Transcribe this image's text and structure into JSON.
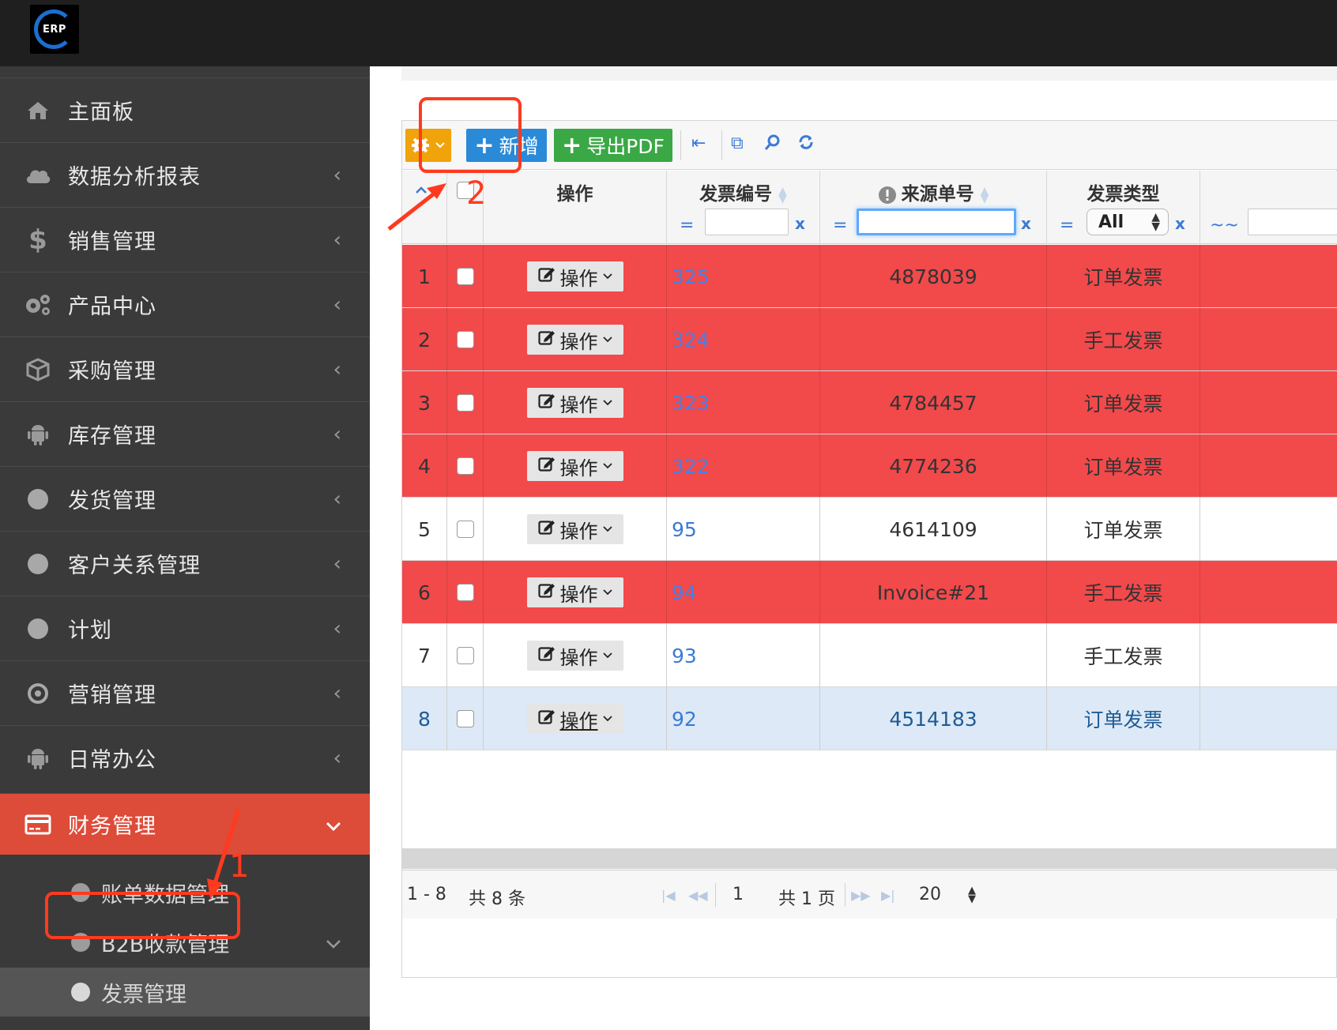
{
  "header": {
    "logo_text": "ERP"
  },
  "sidebar": {
    "items": [
      {
        "label": "主面板",
        "icon": "home-icon"
      },
      {
        "label": "数据分析报表",
        "icon": "cloud-icon"
      },
      {
        "label": "销售管理",
        "icon": "dollar-icon"
      },
      {
        "label": "产品中心",
        "icon": "gears-icon"
      },
      {
        "label": "采购管理",
        "icon": "cube-icon"
      },
      {
        "label": "库存管理",
        "icon": "android-icon"
      },
      {
        "label": "发货管理",
        "icon": "circle-icon"
      },
      {
        "label": "客户关系管理",
        "icon": "circle-icon"
      },
      {
        "label": "计划",
        "icon": "circle-icon"
      },
      {
        "label": "营销管理",
        "icon": "target-icon"
      },
      {
        "label": "日常办公",
        "icon": "android-icon"
      },
      {
        "label": "财务管理",
        "icon": "credit-card-icon"
      }
    ],
    "sub_items": [
      {
        "label": "账单数据管理"
      },
      {
        "label": "B2B收款管理"
      },
      {
        "label": "发票管理"
      }
    ],
    "chevron_left": "‹",
    "chevron_down": "⌄"
  },
  "toolbar": {
    "add_label": "新增",
    "export_label": "导出PDF",
    "plus": "+"
  },
  "table": {
    "columns": {
      "action": "操作",
      "invoice_no": "发票编号",
      "source_no": "来源单号",
      "invoice_type": "发票类型",
      "next_col_op": "~~"
    },
    "filter_eq": "=",
    "filter_clear": "x",
    "type_filter_value": "All",
    "op_button_label": "操作",
    "rows": [
      {
        "n": "1",
        "invoice_no": "325",
        "source_no": "4878039",
        "type": "订单发票",
        "style": "red"
      },
      {
        "n": "2",
        "invoice_no": "324",
        "source_no": "",
        "type": "手工发票",
        "style": "red"
      },
      {
        "n": "3",
        "invoice_no": "323",
        "source_no": "4784457",
        "type": "订单发票",
        "style": "red"
      },
      {
        "n": "4",
        "invoice_no": "322",
        "source_no": "4774236",
        "type": "订单发票",
        "style": "red"
      },
      {
        "n": "5",
        "invoice_no": "95",
        "source_no": "4614109",
        "type": "订单发票",
        "style": "white"
      },
      {
        "n": "6",
        "invoice_no": "94",
        "source_no": "Invoice#21",
        "type": "手工发票",
        "style": "red"
      },
      {
        "n": "7",
        "invoice_no": "93",
        "source_no": "",
        "type": "手工发票",
        "style": "white"
      },
      {
        "n": "8",
        "invoice_no": "92",
        "source_no": "4514183",
        "type": "订单发票",
        "style": "selected"
      }
    ]
  },
  "pager": {
    "range": "1 - 8",
    "total": "共 8 条",
    "page": "1",
    "pages": "共 1 页",
    "page_size": "20"
  },
  "annotations": {
    "label_1": "1",
    "label_2": "2"
  },
  "colors": {
    "accent_red": "#dd4b39",
    "row_red": "#f2494b",
    "annotation": "#ff3a1f",
    "link_blue": "#3a7bd5"
  }
}
